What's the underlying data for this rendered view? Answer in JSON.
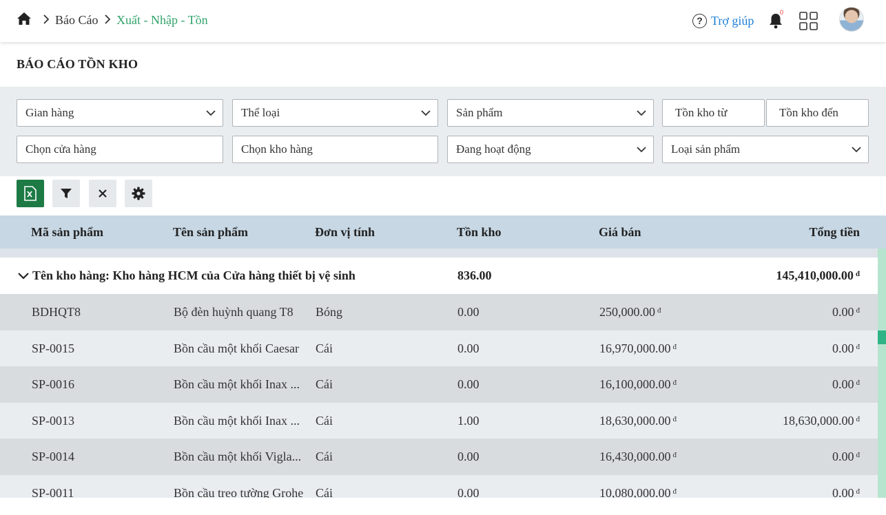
{
  "breadcrumb": {
    "items": [
      "Báo Cáo",
      "Xuất - Nhập - Tồn"
    ]
  },
  "header": {
    "help_label": "Trợ giúp",
    "notification_count": "0"
  },
  "page": {
    "title": "BÁO CÁO TỒN KHO"
  },
  "filters": {
    "store": "Gian hàng",
    "category": "Thể loại",
    "product": "Sản phẩm",
    "stock_from": "Tồn kho từ",
    "stock_to": "Tồn kho đến",
    "choose_shop": "Chọn cửa hàng",
    "choose_warehouse": "Chọn kho hàng",
    "status": "Đang hoạt động",
    "product_type": "Loại sản phẩm"
  },
  "table": {
    "columns": [
      "Mã sản phẩm",
      "Tên sản phẩm",
      "Đơn vị tính",
      "Tồn kho",
      "Giá bán",
      "Tổng tiền"
    ],
    "currency": "đ",
    "group": {
      "label": "Tên kho hàng: Kho hàng HCM của Cửa hàng thiết bị vệ sinh",
      "stock": "836.00",
      "total": "145,410,000.00"
    },
    "rows": [
      {
        "code": "BDHQT8",
        "name": "Bộ đèn huỳnh quang T8",
        "unit": "Bóng",
        "stock": "0.00",
        "price": "250,000.00",
        "total": "0.00"
      },
      {
        "code": "SP-0015",
        "name": "Bồn cầu một khối Caesar",
        "unit": "Cái",
        "stock": "0.00",
        "price": "16,970,000.00",
        "total": "0.00"
      },
      {
        "code": "SP-0016",
        "name": "Bồn cầu một khối Inax ...",
        "unit": "Cái",
        "stock": "0.00",
        "price": "16,100,000.00",
        "total": "0.00"
      },
      {
        "code": "SP-0013",
        "name": "Bồn cầu một khối Inax ...",
        "unit": "Cái",
        "stock": "1.00",
        "price": "18,630,000.00",
        "total": "18,630,000.00"
      },
      {
        "code": "SP-0014",
        "name": "Bồn cầu một khối Vigla...",
        "unit": "Cái",
        "stock": "0.00",
        "price": "16,430,000.00",
        "total": "0.00"
      },
      {
        "code": "SP-0011",
        "name": "Bồn cầu treo tường Grohe",
        "unit": "Cái",
        "stock": "0.00",
        "price": "10,080,000.00",
        "total": "0.00"
      }
    ]
  },
  "colors": {
    "accent_green": "#33a36b",
    "link_blue": "#1e7fd6",
    "excel_green": "#1d7a45",
    "table_header": "#c7d7e4"
  }
}
